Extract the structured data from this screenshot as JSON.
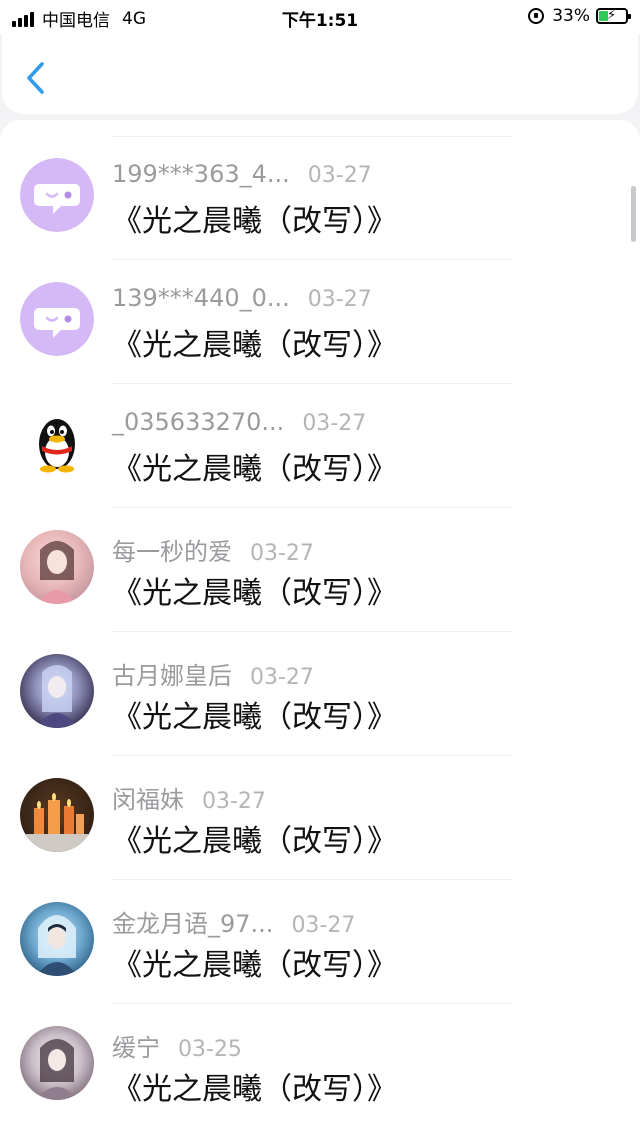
{
  "status_bar": {
    "carrier": "中国电信",
    "network": "4G",
    "time": "下午1:51",
    "battery": "33%"
  },
  "colors": {
    "accent": "#2f9cf0",
    "wechat_avatar": "#d5b8f6"
  },
  "items": [
    {
      "user": "199***363_4...",
      "date": "03-27",
      "title": "《光之晨曦（改写）》",
      "avatar": "chat-bubble-icon"
    },
    {
      "user": "139***440_0...",
      "date": "03-27",
      "title": "《光之晨曦（改写）》",
      "avatar": "chat-bubble-icon"
    },
    {
      "user": "_035633270...",
      "date": "03-27",
      "title": "《光之晨曦（改写）》",
      "avatar": "penguin-icon"
    },
    {
      "user": "每一秒的爱",
      "date": "03-27",
      "title": "《光之晨曦（改写）》",
      "avatar": "photo"
    },
    {
      "user": "古月娜皇后",
      "date": "03-27",
      "title": "《光之晨曦（改写）》",
      "avatar": "photo"
    },
    {
      "user": "闵福妹",
      "date": "03-27",
      "title": "《光之晨曦（改写）》",
      "avatar": "photo"
    },
    {
      "user": "金龙月语_97...",
      "date": "03-27",
      "title": "《光之晨曦（改写）》",
      "avatar": "photo"
    },
    {
      "user": "缓宁",
      "date": "03-25",
      "title": "《光之晨曦（改写）》",
      "avatar": "photo"
    }
  ]
}
